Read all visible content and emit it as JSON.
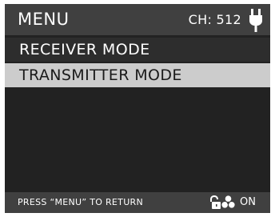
{
  "header": {
    "title": "MENU",
    "channel": "CH: 512",
    "power_icon": "plug-icon"
  },
  "menu": {
    "items": [
      {
        "label": "RECEIVER MODE",
        "selected": false
      },
      {
        "label": "TRANSMITTER MODE",
        "selected": true
      }
    ]
  },
  "footer": {
    "hint": "PRESS “MENU” TO RETURN",
    "lock_icon": "unlock-icon",
    "fan_icon": "fan-icon",
    "fan_state": "ON"
  },
  "colors": {
    "background": "#222222",
    "header_bar": "#404040",
    "selected_row": "#cccccc",
    "text": "#ffffff"
  }
}
